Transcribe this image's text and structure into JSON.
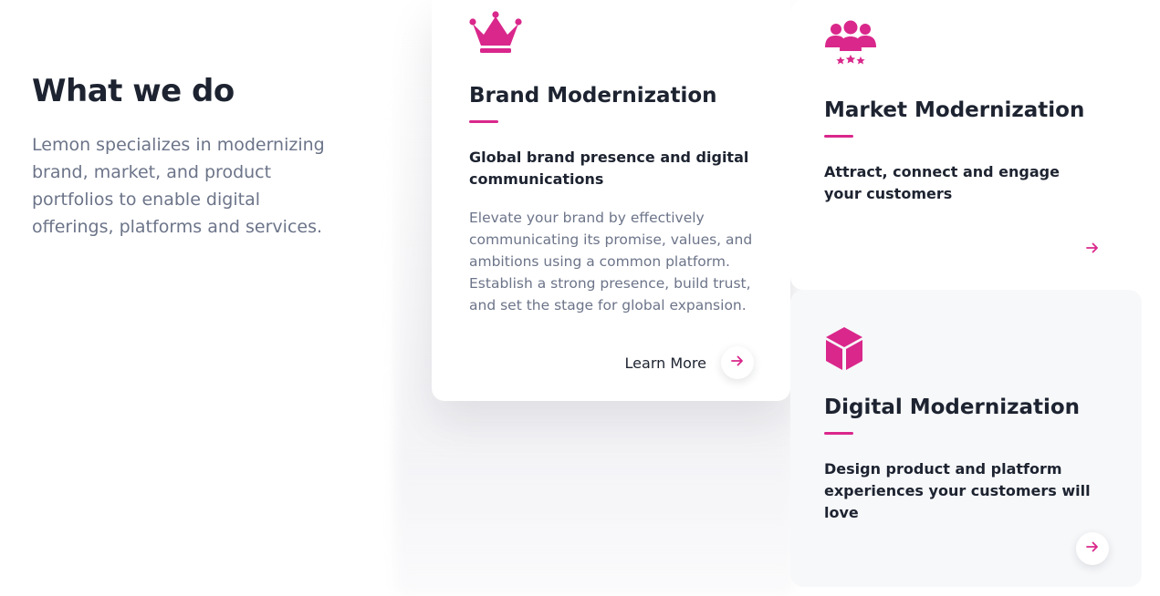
{
  "intro": {
    "heading": "What we do",
    "description": "Lemon specializes in modernizing brand, market, and product portfolios to enable digital offerings, platforms and services."
  },
  "colors": {
    "accent": "#d9278b",
    "heading": "#1d2330",
    "muted": "#6c7489"
  },
  "cards": {
    "brand": {
      "icon": "crown-icon",
      "title": "Brand Modernization",
      "subtitle": "Global brand presence and digital communications",
      "body": "Elevate your brand by effectively communicating its promise, values, and ambitions using a common platform. Establish a strong presence, build trust, and set the stage for global expansion.",
      "cta_label": "Learn More"
    },
    "market": {
      "icon": "people-stars-icon",
      "title": "Market Modernization",
      "subtitle": "Attract, connect and engage your customers"
    },
    "digital": {
      "icon": "cube-icon",
      "title": "Digital Modernization",
      "subtitle": "Design product and platform experiences your customers will love"
    }
  }
}
